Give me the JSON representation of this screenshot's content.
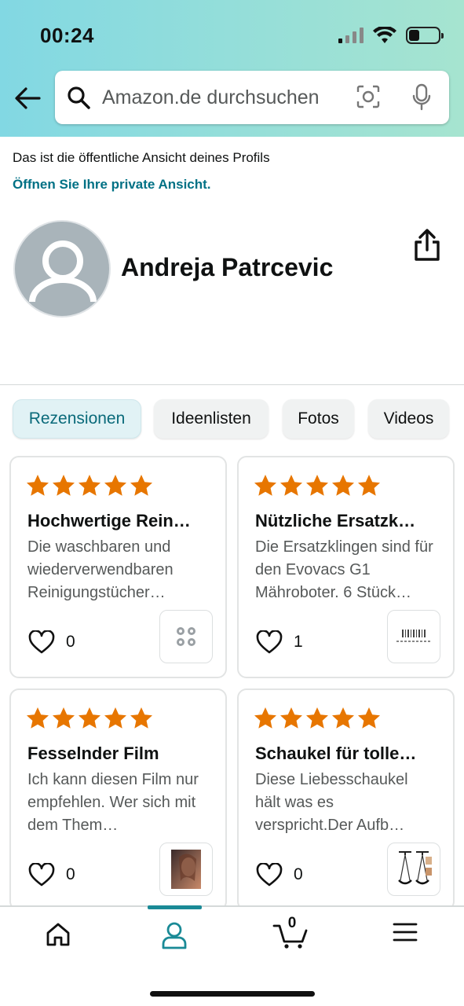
{
  "status_bar": {
    "time": "00:24",
    "battery_level": 0.35
  },
  "search": {
    "placeholder": "Amazon.de durchsuchen"
  },
  "profile": {
    "public_note": "Das ist die öffentliche Ansicht deines Profils",
    "private_link": "Öffnen Sie Ihre private Ansicht.",
    "name": "Andreja Patrcevic"
  },
  "tabs": [
    {
      "label": "Rezensionen",
      "active": true
    },
    {
      "label": "Ideenlisten",
      "active": false
    },
    {
      "label": "Fotos",
      "active": false
    },
    {
      "label": "Videos",
      "active": false
    }
  ],
  "reviews": [
    {
      "rating": 5,
      "title": "Hochwertige Rein…",
      "text": "Die waschbaren und wiederverwendbaren Reinigungstücher…",
      "likes": "0",
      "thumb_icon": "reinigungstuecher-product-image"
    },
    {
      "rating": 5,
      "title": "Nützliche Ersatzk…",
      "text": "Die Ersatzklingen sind für den Evovacs G1 Mähroboter. 6 Stück…",
      "likes": "1",
      "thumb_icon": "ersatzklingen-product-image"
    },
    {
      "rating": 5,
      "title": "Fesselnder Film",
      "text": "Ich kann diesen Film nur empfehlen. Wer sich mit dem Them…",
      "likes": "0",
      "thumb_icon": "film-cover-image"
    },
    {
      "rating": 5,
      "title": "Schaukel für tolle…",
      "text": "Diese Liebesschaukel hält was es verspricht.Der Aufb…",
      "likes": "0",
      "thumb_icon": "schaukel-product-image"
    }
  ],
  "bottom_nav": {
    "items": [
      "home-icon",
      "profile-icon",
      "cart-icon",
      "menu-icon"
    ],
    "active": "profile-icon",
    "cart_count": "0"
  },
  "colors": {
    "star": "#e77600",
    "link": "#007185",
    "accent": "#1a8a96"
  }
}
